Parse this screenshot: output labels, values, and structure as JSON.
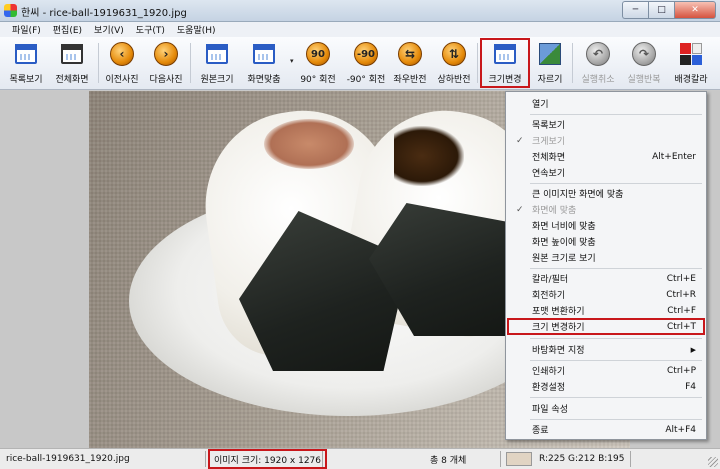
{
  "window": {
    "title": "한씨 - rice-ball-1919631_1920.jpg",
    "buttons": {
      "minimize": "─",
      "maximize": "□",
      "close": "✕"
    }
  },
  "menubar": [
    {
      "id": "file",
      "label": "파일(F)"
    },
    {
      "id": "edit",
      "label": "편집(E)"
    },
    {
      "id": "view",
      "label": "보기(V)"
    },
    {
      "id": "tools",
      "label": "도구(T)"
    },
    {
      "id": "help",
      "label": "도움말(H)"
    }
  ],
  "toolbar": {
    "list_view": "목록보기",
    "fullscreen": "전체화면",
    "prev": "이전사진",
    "next": "다음사진",
    "original_size": "원본크기",
    "fit_screen": "화면맞춤",
    "rotate_90": "90° 회전",
    "rotate_neg90": "-90° 회전",
    "flip_h": "좌우반전",
    "flip_v": "상하반전",
    "resize": "크기변경",
    "crop": "자르기",
    "undo": "실행취소",
    "redo": "실행반복",
    "bg_color": "배경칼라",
    "icons": {
      "rotate_90_glyph": "90",
      "rotate_neg90_glyph": "-90",
      "prev_glyph": "‹",
      "next_glyph": "›",
      "flip_h_glyph": "⇆",
      "flip_v_glyph": "⇅"
    }
  },
  "context_menu": {
    "items": [
      {
        "id": "open",
        "label": "열기",
        "shortcut": ""
      },
      {
        "id": "list",
        "label": "목록보기",
        "shortcut": ""
      },
      {
        "id": "large",
        "label": "크게보기",
        "shortcut": "",
        "checked": true,
        "disabled": true
      },
      {
        "id": "fullscreen",
        "label": "전체화면",
        "shortcut": "Alt+Enter"
      },
      {
        "id": "continuous",
        "label": "연속보기",
        "shortcut": ""
      },
      {
        "id": "fit_large",
        "label": "큰 이미지만 화면에 맞춤",
        "shortcut": ""
      },
      {
        "id": "fit_screen",
        "label": "화면에 맞춤",
        "shortcut": "",
        "checked": true,
        "disabled": true
      },
      {
        "id": "fit_width",
        "label": "화면 너비에 맞춤",
        "shortcut": ""
      },
      {
        "id": "fit_height",
        "label": "화면 높이에 맞춤",
        "shortcut": ""
      },
      {
        "id": "original",
        "label": "원본 크기로 보기",
        "shortcut": ""
      },
      {
        "id": "color_filter",
        "label": "칼라/필터",
        "shortcut": "Ctrl+E"
      },
      {
        "id": "rotate",
        "label": "회전하기",
        "shortcut": "Ctrl+R"
      },
      {
        "id": "format",
        "label": "포맷 변환하기",
        "shortcut": "Ctrl+F"
      },
      {
        "id": "resize",
        "label": "크기 변경하기",
        "shortcut": "Ctrl+T"
      },
      {
        "id": "wallpaper",
        "label": "바탕화면 지정",
        "shortcut": "",
        "submenu": true
      },
      {
        "id": "print",
        "label": "인쇄하기",
        "shortcut": "Ctrl+P"
      },
      {
        "id": "settings",
        "label": "환경설정",
        "shortcut": "F4"
      },
      {
        "id": "props",
        "label": "파일 속성",
        "shortcut": ""
      },
      {
        "id": "exit",
        "label": "종료",
        "shortcut": "Alt+F4"
      }
    ],
    "submenu_arrow": "▶",
    "check_glyph": "✓"
  },
  "statusbar": {
    "filename": "rice-ball-1919631_1920.jpg",
    "image_size": "이미지 크기: 1920 x 1276",
    "count": "총 8 개체",
    "pixel": "R:225 G:212 B:195",
    "swatch_color": "#e1d4c3"
  },
  "colors": {
    "accent_highlight": "#c8171b"
  }
}
